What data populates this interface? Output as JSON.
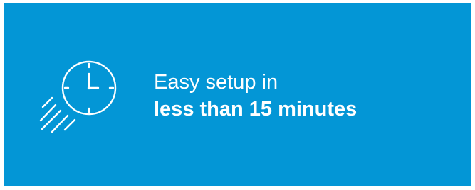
{
  "banner": {
    "background_color": "#0396d6",
    "text_color": "#ffffff",
    "icon": "fast-clock-icon",
    "line1": "Easy setup in",
    "line2": "less than 15 minutes"
  }
}
